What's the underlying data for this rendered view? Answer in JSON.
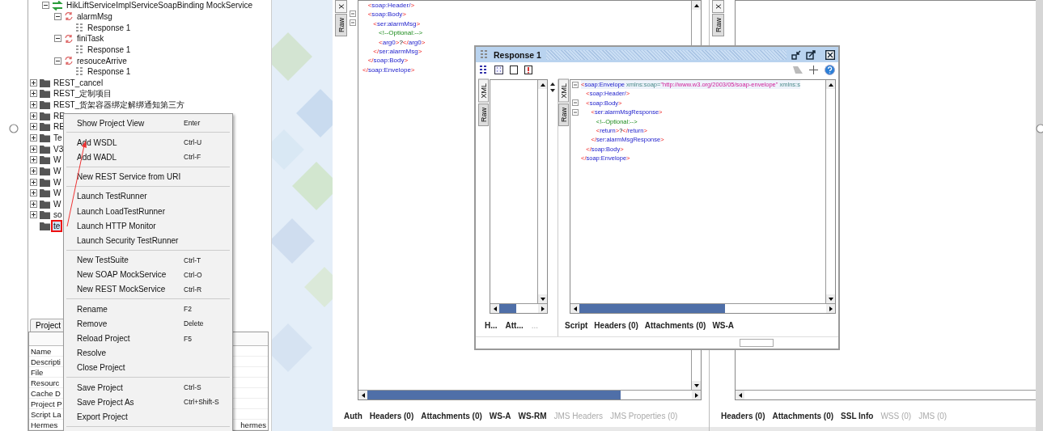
{
  "tree": {
    "continued": [
      {
        "label": "HikLiftServiceImplServiceSoapBinding MockService",
        "kind": "mockservice",
        "expanded": true,
        "selected": false,
        "children": [
          {
            "label": "alarmMsg",
            "kind": "operation",
            "expanded": true,
            "selected": false,
            "children": [
              {
                "label": "Response 1",
                "kind": "response",
                "selected": false
              }
            ]
          },
          {
            "label": "finiTask",
            "kind": "operation",
            "expanded": true,
            "selected": false,
            "children": [
              {
                "label": "Response 1",
                "kind": "response",
                "selected": false
              }
            ]
          },
          {
            "label": "resouceArrive",
            "kind": "operation",
            "expanded": true,
            "selected": false,
            "children": [
              {
                "label": "Response 1",
                "kind": "response",
                "selected": false
              }
            ]
          }
        ]
      }
    ],
    "items": [
      {
        "label": "REST_cancel",
        "kind": "project",
        "expanded": false,
        "selected": false
      },
      {
        "label": "REST_定制项目",
        "kind": "project",
        "expanded": false,
        "selected": false
      },
      {
        "label": "REST_货架容器绑定解绑通知第三方",
        "kind": "project",
        "expanded": false,
        "selected": false
      },
      {
        "label": "RE",
        "kind": "project",
        "expanded": false,
        "selected": false
      },
      {
        "label": "RE",
        "kind": "project",
        "expanded": false,
        "selected": false
      },
      {
        "label": "Te",
        "kind": "project",
        "expanded": false,
        "selected": false
      },
      {
        "label": "V3",
        "kind": "project",
        "expanded": false,
        "selected": false
      },
      {
        "label": "W",
        "kind": "project",
        "expanded": false,
        "selected": false
      },
      {
        "label": "W",
        "kind": "project",
        "expanded": false,
        "selected": false
      },
      {
        "label": "W",
        "kind": "project",
        "expanded": false,
        "selected": false
      },
      {
        "label": "W",
        "kind": "project",
        "expanded": false,
        "selected": false
      },
      {
        "label": "W",
        "kind": "project",
        "expanded": false,
        "selected": false
      },
      {
        "label": "so",
        "kind": "project",
        "expanded": false,
        "selected": false
      },
      {
        "label": "te",
        "kind": "project",
        "selected": true
      }
    ]
  },
  "properties_panel": {
    "tab": "Project",
    "rows": [
      {
        "name": "Name"
      },
      {
        "name": "Descripti"
      },
      {
        "name": "File"
      },
      {
        "name": "Resourc"
      },
      {
        "name": "Cache D"
      },
      {
        "name": "Project P"
      },
      {
        "name": "Script La"
      },
      {
        "name": "Hermes",
        "value": "hermes"
      }
    ]
  },
  "context_menu": {
    "sections": [
      [
        {
          "label": "Show Project View",
          "shortcut": "Enter"
        }
      ],
      [
        {
          "label": "Add WSDL",
          "shortcut": "Ctrl-U"
        },
        {
          "label": "Add WADL",
          "shortcut": "Ctrl-F"
        }
      ],
      [
        {
          "label": "New REST Service from URI"
        }
      ],
      [
        {
          "label": "Launch TestRunner"
        },
        {
          "label": "Launch LoadTestRunner"
        },
        {
          "label": "Launch HTTP Monitor"
        },
        {
          "label": "Launch Security TestRunner"
        }
      ],
      [
        {
          "label": "New TestSuite",
          "shortcut": "Ctrl-T"
        },
        {
          "label": "New SOAP MockService",
          "shortcut": "Ctrl-O"
        },
        {
          "label": "New REST MockService",
          "shortcut": "Ctrl-R"
        }
      ],
      [
        {
          "label": "Rename",
          "shortcut": "F2"
        },
        {
          "label": "Remove",
          "shortcut": "Delete"
        },
        {
          "label": "Reload Project",
          "shortcut": "F5"
        },
        {
          "label": "Resolve"
        },
        {
          "label": "Close Project"
        }
      ],
      [
        {
          "label": "Save Project",
          "shortcut": "Ctrl-S"
        },
        {
          "label": "Save Project As",
          "shortcut": "Ctrl+Shift-S"
        },
        {
          "label": "Export Project"
        }
      ]
    ]
  },
  "request_editor": {
    "view_tabs": [
      {
        "label": "X",
        "selected": true
      },
      {
        "label": "Raw",
        "selected": false
      }
    ],
    "xml_lines": [
      {
        "text": "   <soap:Header/>",
        "collapsible": false
      },
      {
        "text": "   <soap:Body>",
        "collapsible": true
      },
      {
        "text": "      <ser:alarmMsg>",
        "collapsible": true
      },
      {
        "text": "         <!--Optional:-->",
        "collapsible": false
      },
      {
        "text": "         <arg0>?</arg0>",
        "collapsible": false
      },
      {
        "text": "      </ser:alarmMsg>",
        "collapsible": false
      },
      {
        "text": "   </soap:Body>",
        "collapsible": false
      },
      {
        "text": "</soap:Envelope>",
        "collapsible": false
      }
    ],
    "bottom_tabs": [
      {
        "label": "Auth",
        "disabled": false
      },
      {
        "label": "Headers (0)",
        "disabled": false
      },
      {
        "label": "Attachments (0)",
        "disabled": false
      },
      {
        "label": "WS-A",
        "disabled": false
      },
      {
        "label": "WS-RM",
        "disabled": false
      },
      {
        "label": "JMS Headers",
        "disabled": true
      },
      {
        "label": "JMS Properties (0)",
        "disabled": true
      }
    ]
  },
  "response_editor": {
    "view_tabs": [
      {
        "label": "X",
        "selected": true
      },
      {
        "label": "Raw",
        "selected": false
      }
    ],
    "bottom_tabs": [
      {
        "label": "Headers (0)",
        "disabled": false
      },
      {
        "label": "Attachments (0)",
        "disabled": false
      },
      {
        "label": "SSL Info",
        "disabled": false
      },
      {
        "label": "WSS (0)",
        "disabled": true
      },
      {
        "label": "JMS (0)",
        "disabled": true
      }
    ]
  },
  "response_window": {
    "title": "Response 1",
    "left_pane": {
      "view_tabs": [
        {
          "label": "XML",
          "selected": true
        },
        {
          "label": "Raw",
          "selected": false
        }
      ],
      "bottom_tabs": [
        {
          "label": "H...",
          "disabled": false
        },
        {
          "label": "Att...",
          "disabled": false
        },
        {
          "label": "...",
          "disabled": true
        }
      ]
    },
    "right_pane": {
      "view_tabs": [
        {
          "label": "XML",
          "selected": true
        },
        {
          "label": "Raw",
          "selected": false
        }
      ],
      "xml_lines": [
        {
          "text": "<soap:Envelope xmlns:soap=\"http://www.w3.org/2003/05/soap-envelope\" xmlns:s",
          "collapsible": true
        },
        {
          "text": "   <soap:Header/>",
          "collapsible": false
        },
        {
          "text": "   <soap:Body>",
          "collapsible": true
        },
        {
          "text": "      <ser:alarmMsgResponse>",
          "collapsible": true
        },
        {
          "text": "         <!--Optional:-->",
          "collapsible": false
        },
        {
          "text": "         <return>?</return>",
          "collapsible": false
        },
        {
          "text": "      </ser:alarmMsgResponse>",
          "collapsible": false
        },
        {
          "text": "   </soap:Body>",
          "collapsible": false
        },
        {
          "text": "</soap:Envelope>",
          "collapsible": false
        }
      ],
      "bottom_tabs": [
        {
          "label": "Script",
          "disabled": false
        },
        {
          "label": "Headers (0)",
          "disabled": false
        },
        {
          "label": "Attachments (0)",
          "disabled": false
        },
        {
          "label": "WS-A",
          "disabled": false
        }
      ]
    }
  }
}
